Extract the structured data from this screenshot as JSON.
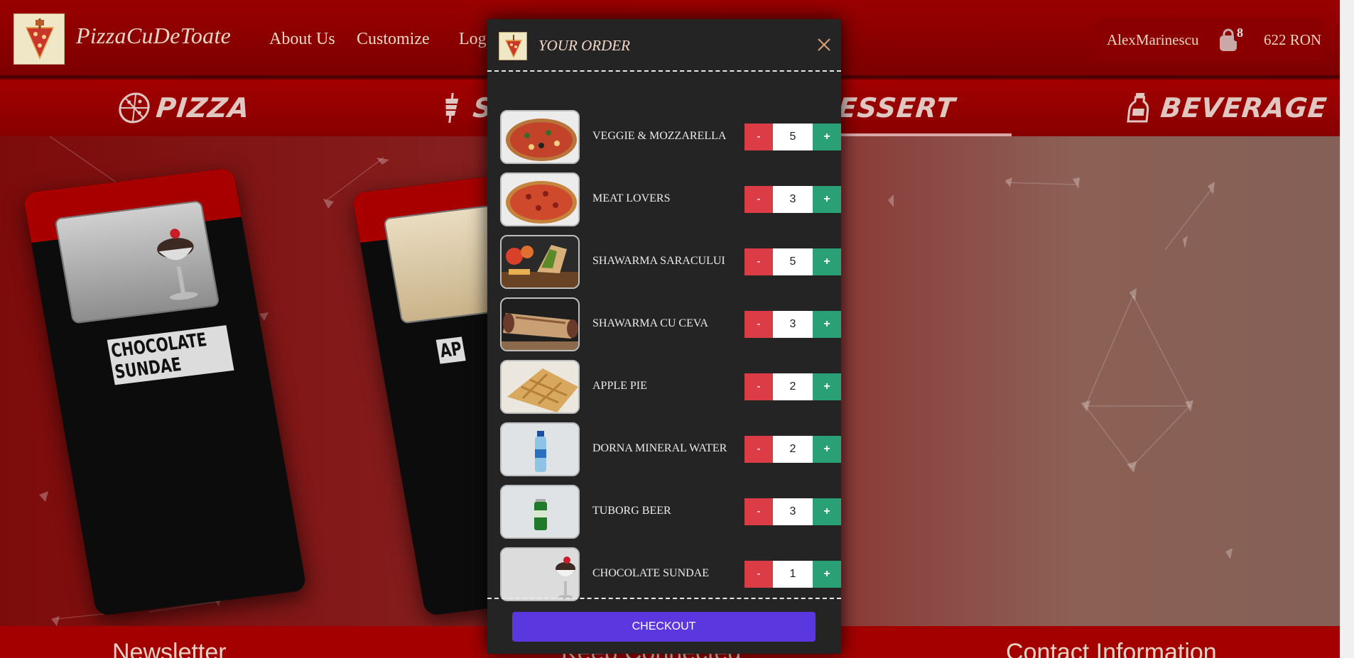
{
  "header": {
    "brand": "PizzaCuDeToate",
    "nav": [
      "About Us",
      "Customize",
      "Log"
    ],
    "username": "AlexMarinescu",
    "cart_count": "8",
    "balance": "622 RON"
  },
  "categories": [
    {
      "label": "PIZZA",
      "icon": "pizza-icon"
    },
    {
      "label": "SH",
      "icon": "shawarma-icon"
    },
    {
      "label": "ESSERT",
      "icon": "dessert-icon"
    },
    {
      "label": "BEVERAGE",
      "icon": "bottle-icon"
    }
  ],
  "cards": [
    {
      "label": "CHOCOLATE SUNDAE"
    },
    {
      "label": "AP"
    }
  ],
  "footer": {
    "sections": [
      "Newsletter",
      "Keep Connected",
      "Contact Information"
    ]
  },
  "modal": {
    "title": "YOUR ORDER",
    "items": [
      {
        "name": "VEGGIE & MOZZARELLA",
        "quantity": "5",
        "image": "pizza-veggie"
      },
      {
        "name": "MEAT LOVERS",
        "quantity": "3",
        "image": "pizza-meat"
      },
      {
        "name": "SHAWARMA SARACULUI",
        "quantity": "5",
        "image": "shawarma-plate"
      },
      {
        "name": "SHAWARMA CU CEVA",
        "quantity": "3",
        "image": "shawarma-wrap"
      },
      {
        "name": "APPLE PIE",
        "quantity": "2",
        "image": "apple-pie"
      },
      {
        "name": "DORNA MINERAL WATER",
        "quantity": "2",
        "image": "water-bottle"
      },
      {
        "name": "TUBORG BEER",
        "quantity": "3",
        "image": "beer-can"
      },
      {
        "name": "CHOCOLATE SUNDAE",
        "quantity": "1",
        "image": "sundae"
      }
    ],
    "minus_label": "-",
    "plus_label": "+",
    "checkout_label": "CHECKOUT"
  },
  "colors": {
    "header_red": "#9a0000",
    "modal_bg": "#242424",
    "minus_red": "#dc3c46",
    "plus_green": "#2aa077",
    "checkout_purple": "#5b37e0"
  }
}
